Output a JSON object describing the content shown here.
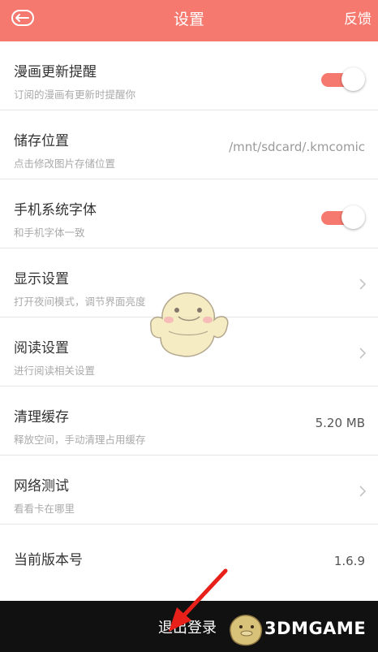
{
  "header": {
    "title": "设置",
    "feedback": "反馈"
  },
  "settings": [
    {
      "label": "漫画更新提醒",
      "sub": "订阅的漫画有更新时提醒你",
      "control": "toggle",
      "on": true
    },
    {
      "label": "储存位置",
      "sub": "点击修改图片存储位置",
      "value": "/mnt/sdcard/.kmcomic"
    },
    {
      "label": "手机系统字体",
      "sub": "和手机字体一致",
      "control": "toggle",
      "on": true
    },
    {
      "label": "显示设置",
      "sub": "打开夜间模式，调节界面亮度",
      "control": "chevron"
    },
    {
      "label": "阅读设置",
      "sub": "进行阅读相关设置",
      "control": "chevron"
    },
    {
      "label": "清理缓存",
      "sub": "释放空间，手动清理占用缓存",
      "value": "5.20 MB"
    },
    {
      "label": "网络测试",
      "sub": "看看卡在哪里",
      "control": "chevron"
    },
    {
      "label": "当前版本号",
      "value": "1.6.9"
    }
  ],
  "footer": {
    "logout": "退出登录",
    "watermark": "3DMGAME"
  },
  "colors": {
    "accent": "#f6796f",
    "footer_bg": "#111111",
    "arrow": "#e8201a"
  }
}
